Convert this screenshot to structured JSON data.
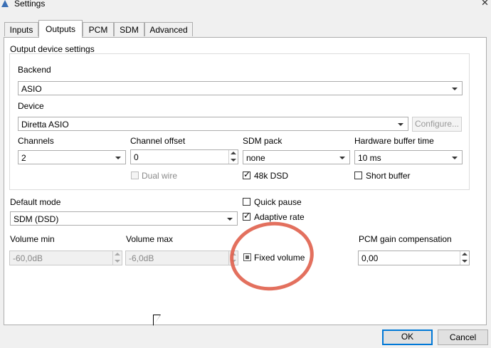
{
  "window": {
    "title": "Settings"
  },
  "tabs": [
    {
      "label": "Inputs"
    },
    {
      "label": "Outputs",
      "active": true
    },
    {
      "label": "PCM"
    },
    {
      "label": "SDM"
    },
    {
      "label": "Advanced"
    }
  ],
  "group": {
    "title": "Output device settings",
    "backend": {
      "label": "Backend",
      "value": "ASIO"
    },
    "device": {
      "label": "Device",
      "value": "Diretta ASIO",
      "configure_label": "Configure..."
    },
    "channels": {
      "label": "Channels",
      "value": "2"
    },
    "channel_offset": {
      "label": "Channel offset",
      "value": "0"
    },
    "sdm_pack": {
      "label": "SDM pack",
      "value": "none"
    },
    "hw_buffer": {
      "label": "Hardware buffer time",
      "value": "10 ms"
    },
    "dual_wire": {
      "label": "Dual wire",
      "checked": false,
      "disabled": true
    },
    "dsd48k": {
      "label": "48k DSD",
      "checked": true
    },
    "short_buffer": {
      "label": "Short buffer",
      "checked": false
    }
  },
  "default_mode": {
    "label": "Default mode",
    "value": "SDM (DSD)"
  },
  "quick_pause": {
    "label": "Quick pause",
    "checked": false
  },
  "adaptive_rate": {
    "label": "Adaptive rate",
    "checked": true
  },
  "volume_min": {
    "label": "Volume min",
    "value": "-60,0dB"
  },
  "volume_max": {
    "label": "Volume max",
    "value": "-6,0dB"
  },
  "fixed_volume": {
    "label": "Fixed volume",
    "state": "indeterminate"
  },
  "pcm_gain": {
    "label": "PCM gain compensation",
    "value": "0,00"
  },
  "footer": {
    "ok_label": "OK",
    "cancel_label": "Cancel"
  },
  "colors": {
    "accent": "#0078d7",
    "annotation": "#e0604d"
  }
}
